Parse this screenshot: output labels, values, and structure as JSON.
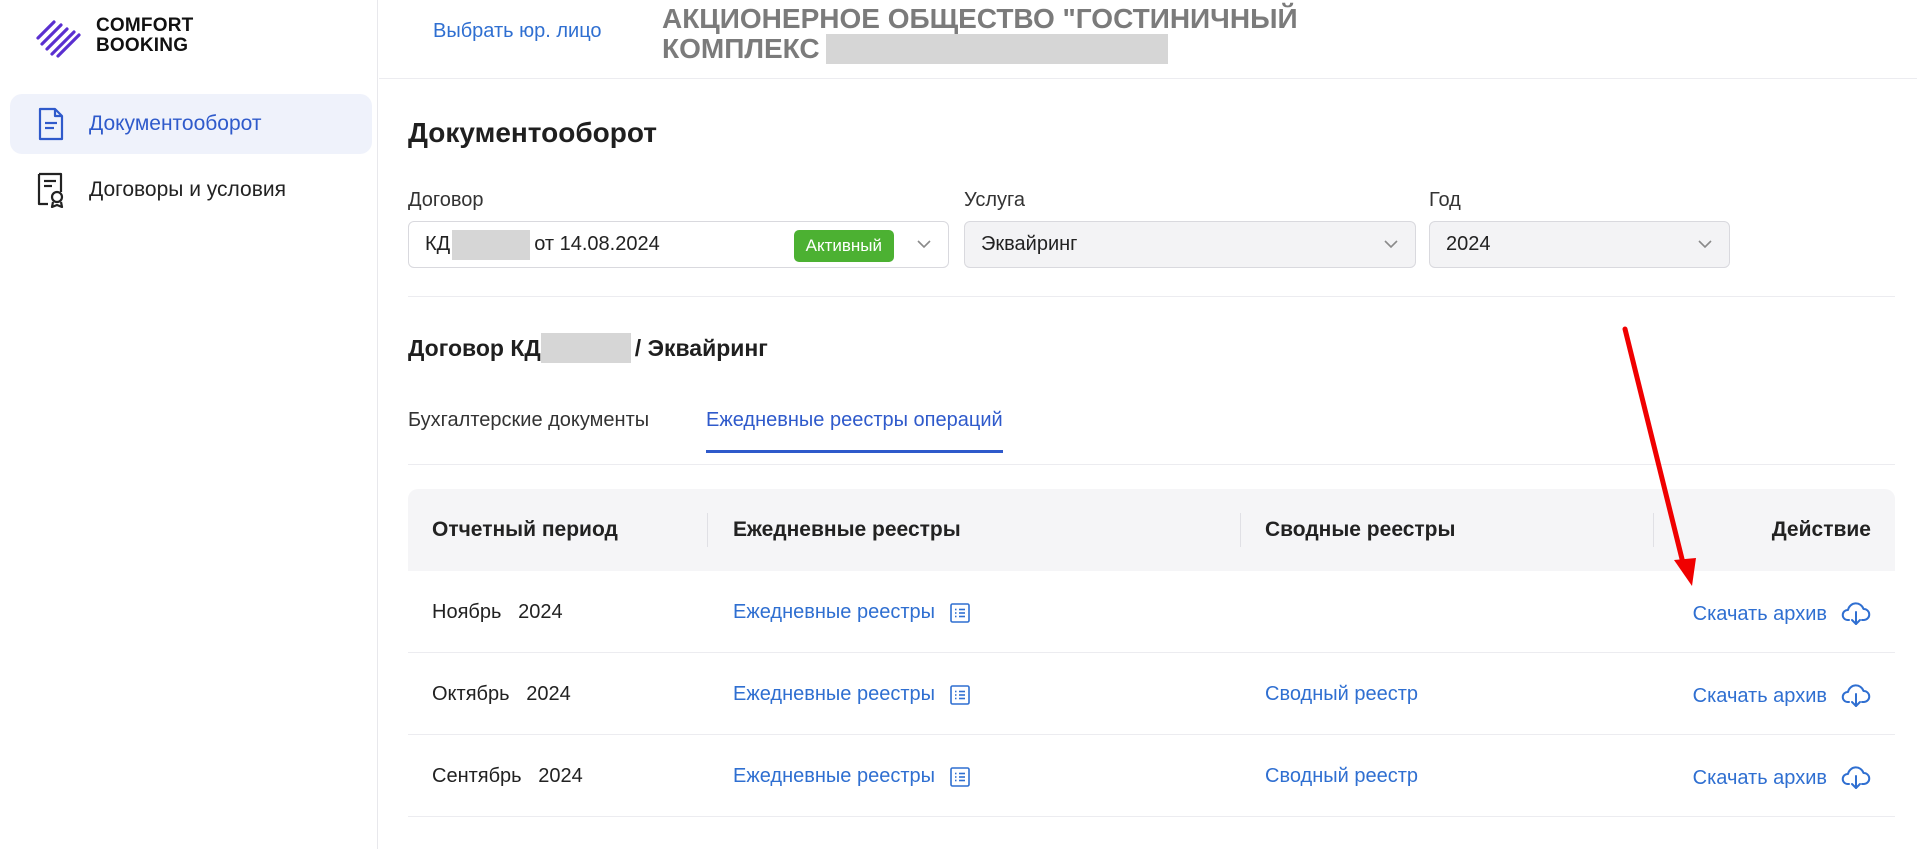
{
  "brand": {
    "line1": "COMFORT",
    "line2": "BOOKING",
    "color": "#5a2fd0"
  },
  "sidebar": {
    "items": [
      {
        "label": "Документооборот",
        "icon": "document-icon",
        "active": true
      },
      {
        "label": "Договоры и условия",
        "icon": "contract-icon",
        "active": false
      }
    ]
  },
  "header": {
    "select_entity": "Выбрать юр. лицо",
    "company_line1": "АКЦИОНЕРНОЕ ОБЩЕСТВО \"ГОСТИНИЧНЫЙ",
    "company_line2": "КОМПЛЕКС"
  },
  "page": {
    "title": "Документооборот"
  },
  "filters": {
    "contract": {
      "label": "Договор",
      "prefix": "КД",
      "suffix": "от 14.08.2024",
      "badge": "Активный"
    },
    "service": {
      "label": "Услуга",
      "value": "Эквайринг"
    },
    "year": {
      "label": "Год",
      "value": "2024"
    }
  },
  "contract_title": {
    "prefix": "Договор КД",
    "suffix": "/ Эквайринг"
  },
  "tabs": [
    {
      "label": "Бухгалтерские документы",
      "active": false
    },
    {
      "label": "Ежедневные реестры операций",
      "active": true
    }
  ],
  "table": {
    "headers": [
      "Отчетный период",
      "Ежедневные реестры",
      "Сводные реестры",
      "Действие"
    ],
    "rows": [
      {
        "month": "Ноябрь",
        "year": "2024",
        "daily": "Ежедневные реестры",
        "summary": "",
        "action": "Скачать архив"
      },
      {
        "month": "Октябрь",
        "year": "2024",
        "daily": "Ежедневные реестры",
        "summary": "Сводный реестр",
        "action": "Скачать архив"
      },
      {
        "month": "Сентябрь",
        "year": "2024",
        "daily": "Ежедневные реестры",
        "summary": "Сводный реестр",
        "action": "Скачать архив"
      }
    ]
  },
  "colors": {
    "accent": "#2f5acb",
    "link": "#2f6fd1",
    "badge": "#4cb132",
    "annotation_arrow": "#f00000"
  }
}
